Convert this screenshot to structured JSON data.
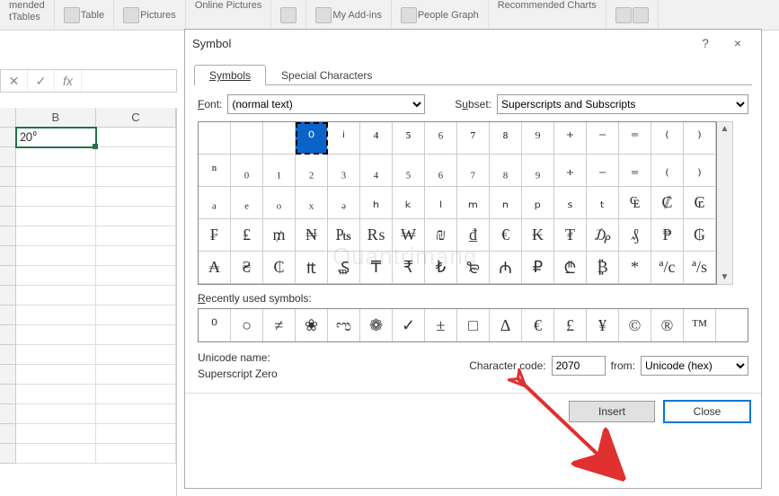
{
  "ribbon": {
    "items": [
      "mended",
      "Table",
      "Pictures",
      "Online Pictures",
      "My Add-ins",
      "People Graph",
      "Recommended Charts"
    ],
    "sub": "tTables"
  },
  "formulabar": {
    "fx": "fx"
  },
  "sheet": {
    "cols": [
      "B",
      "C"
    ],
    "cell_b_value": "20⁰"
  },
  "dialog": {
    "title": "Symbol",
    "help": "?",
    "close": "×",
    "tabs": {
      "symbols": "Symbols",
      "special": "Special Characters"
    },
    "font_label": "Font:",
    "font_value": "(normal text)",
    "subset_label": "Subset:",
    "subset_value": "Superscripts and Subscripts",
    "grid": [
      [
        "",
        "",
        "",
        "⁰",
        "ⁱ",
        "⁴",
        "⁵",
        "⁶",
        "⁷",
        "⁸",
        "⁹",
        "⁺",
        "⁻",
        "⁼",
        "⁽",
        "⁾"
      ],
      [
        "ⁿ",
        "₀",
        "₁",
        "₂",
        "₃",
        "₄",
        "₅",
        "₆",
        "₇",
        "₈",
        "₉",
        "₊",
        "₋",
        "₌",
        "₍",
        "₎"
      ],
      [
        "ₐ",
        "ₑ",
        "ₒ",
        "ₓ",
        "ₔ",
        "ₕ",
        "ₖ",
        "ₗ",
        "ₘ",
        "ₙ",
        "ₚ",
        "ₛ",
        "ₜ",
        "₠",
        "₡",
        "₢"
      ],
      [
        "₣",
        "₤",
        "₥",
        "₦",
        "₧",
        "₨",
        "₩",
        "₪",
        "₫",
        "€",
        "₭",
        "₮",
        "₯",
        "₰",
        "₱",
        "₲"
      ],
      [
        "₳",
        "₴",
        "₵",
        "₶",
        "₷",
        "₸",
        "₹",
        "₺",
        "₻",
        "₼",
        "₽",
        "₾",
        "₿",
        "*",
        "ª/c",
        "ª/s"
      ]
    ],
    "selected_row": 0,
    "selected_col": 3,
    "recent_label": "Recently used symbols:",
    "recent": [
      "⁰",
      "○",
      "≠",
      "❀",
      "ಌ",
      "❁",
      "✓",
      "±",
      "□",
      "Δ",
      "€",
      "£",
      "¥",
      "©",
      "®",
      "™"
    ],
    "unicode_name_label": "Unicode name:",
    "unicode_name_value": "Superscript Zero",
    "char_code_label": "Character code:",
    "char_code_value": "2070",
    "from_label": "from:",
    "from_value": "Unicode (hex)",
    "insert": "Insert",
    "close_btn": "Close"
  }
}
